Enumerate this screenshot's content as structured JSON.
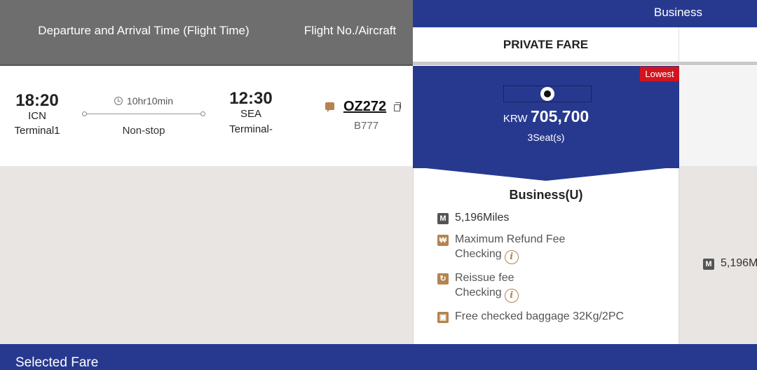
{
  "header": {
    "col_time": "Departure and Arrival Time (Flight Time)",
    "col_flight": "Flight No./Aircraft",
    "cabin_class": "Business",
    "fare_type": "PRIVATE FARE"
  },
  "flight": {
    "dep_time": "18:20",
    "dep_code": "ICN",
    "dep_terminal": "Terminal1",
    "duration": "10hr10min",
    "stops": "Non-stop",
    "arr_time": "12:30",
    "arr_code": "SEA",
    "arr_terminal": "Terminal-",
    "flight_no": "OZ272",
    "aircraft": "B777"
  },
  "fare": {
    "badge": "Lowest",
    "currency": "KRW",
    "amount": "705,700",
    "seats": "3Seat(s)",
    "cabin": "Business(U)",
    "miles": "5,196Miles",
    "refund_label": "Maximum Refund Fee",
    "refund_value": "Checking",
    "reissue_label": "Reissue fee",
    "reissue_value": "Checking",
    "baggage": "Free checked baggage 32Kg/2PC"
  },
  "next_fare": {
    "miles": "5,196M"
  },
  "footer": {
    "selected_fare": "Selected Fare"
  },
  "colors": {
    "brand_blue": "#27398f",
    "lowest_red": "#d2141f",
    "icon_gold": "#b5834d"
  },
  "icons": [
    "clock-icon",
    "chat-icon",
    "copy-icon",
    "miles-icon",
    "won-icon",
    "reissue-icon",
    "baggage-icon",
    "info-icon"
  ]
}
